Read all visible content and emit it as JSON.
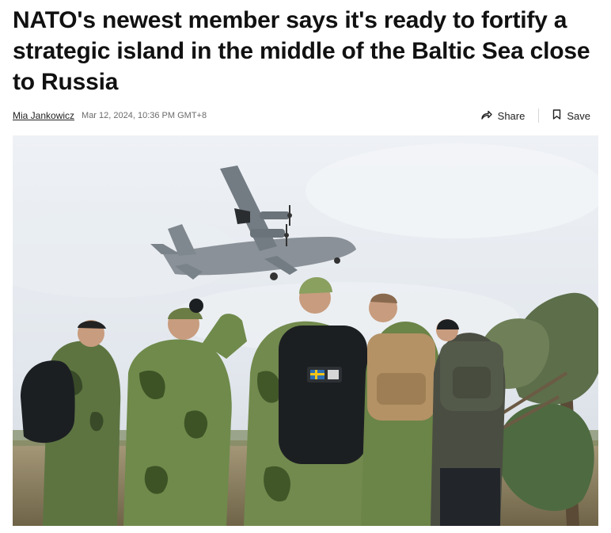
{
  "article": {
    "headline": "NATO's newest member says it's ready to fortify a strategic island in the middle of the Baltic Sea close to Russia",
    "author": "Mia Jankowicz",
    "timestamp": "Mar 12, 2024, 10:36 PM GMT+8"
  },
  "actions": {
    "share_label": "Share",
    "save_label": "Save",
    "share_icon": "share-arrow-icon",
    "save_icon": "bookmark-icon"
  },
  "hero_image": {
    "subject": "Soldiers in camouflage watching a military transport plane fly overhead",
    "colors": {
      "sky": "#e4e8ee",
      "camo_dark": "#3f5a2a",
      "camo_light": "#8fa76a"
    }
  }
}
